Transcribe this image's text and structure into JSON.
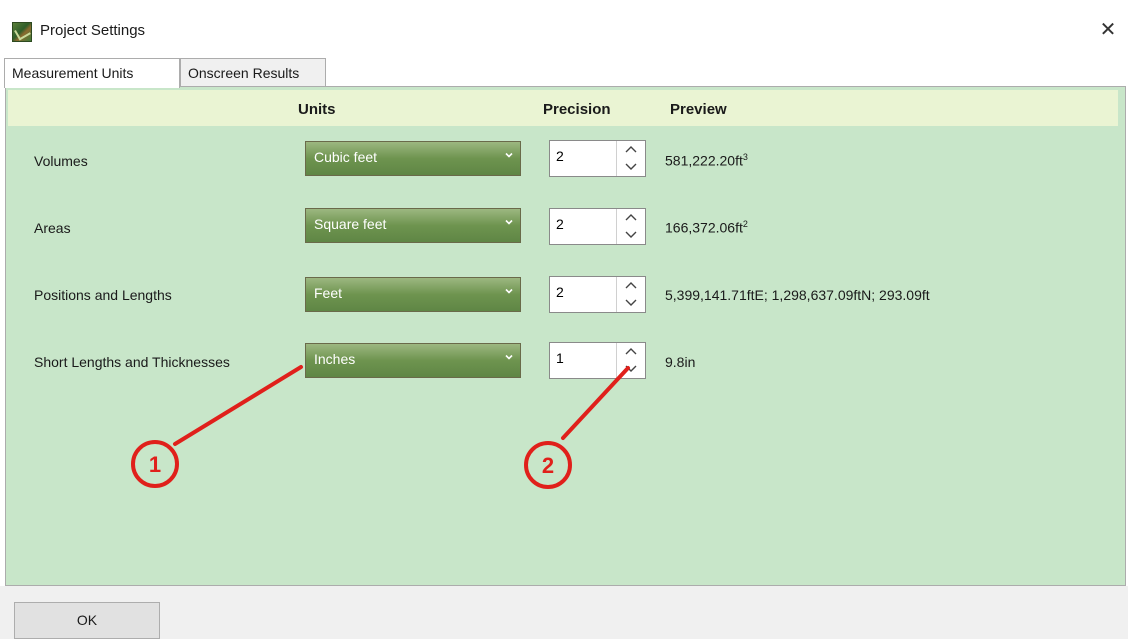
{
  "window": {
    "title": "Project Settings",
    "close_glyph": "✕"
  },
  "tabs": [
    {
      "label": "Measurement Units",
      "active": true
    },
    {
      "label": "Onscreen Results",
      "active": false
    }
  ],
  "table": {
    "headers": {
      "units": "Units",
      "precision": "Precision",
      "preview": "Preview"
    },
    "rows": [
      {
        "label": "Volumes",
        "unit": "Cubic feet",
        "precision": "2",
        "preview": "581,222.20ft",
        "preview_sup": "3"
      },
      {
        "label": "Areas",
        "unit": "Square feet",
        "precision": "2",
        "preview": "166,372.06ft",
        "preview_sup": "2"
      },
      {
        "label": "Positions and Lengths",
        "unit": "Feet",
        "precision": "2",
        "preview": "5,399,141.71ftE; 1,298,637.09ftN; 293.09ft",
        "preview_sup": ""
      },
      {
        "label": "Short Lengths and Thicknesses",
        "unit": "Inches",
        "precision": "1",
        "preview": "9.8in",
        "preview_sup": ""
      }
    ]
  },
  "annotations": [
    {
      "number": "1",
      "points_to": "Inches dropdown"
    },
    {
      "number": "2",
      "points_to": "precision spinner down arrow"
    }
  ],
  "footer": {
    "ok_label": "OK"
  },
  "colors": {
    "panel_bg": "#c8e6c9",
    "header_bg": "#eaf4d3",
    "dropdown_green": "#6e944f",
    "annotation_red": "#e0201b"
  },
  "icons": [
    "app-logo-icon",
    "close-icon",
    "chevron-down-icon",
    "chevron-up-icon"
  ]
}
